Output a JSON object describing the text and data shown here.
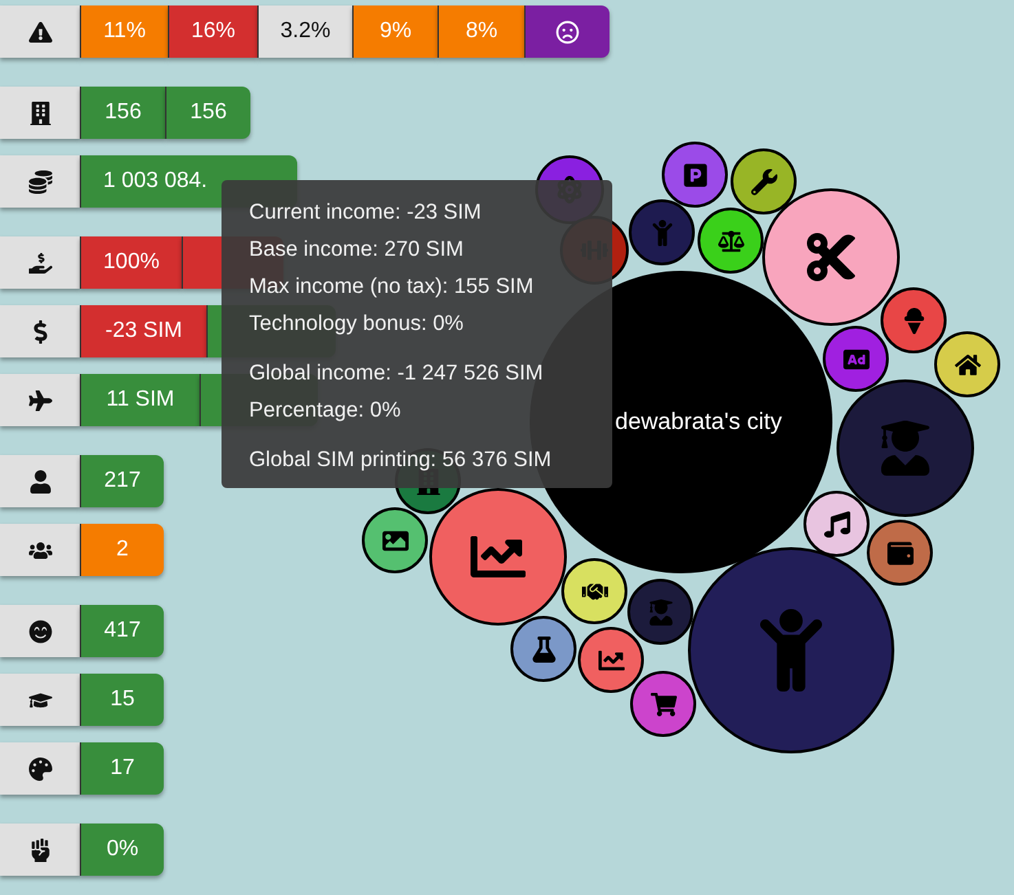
{
  "stat_sections": [
    [
      {
        "segments": [
          {
            "kind": "text",
            "text": "11%",
            "color": "#f57c00"
          },
          {
            "kind": "text",
            "text": "16%",
            "color": "#d32f2f"
          },
          {
            "kind": "text",
            "text": "3.2%",
            "color": "#e0e0e0"
          },
          {
            "kind": "text",
            "text": "9%",
            "color": "#f57c00"
          },
          {
            "kind": "text",
            "text": "8%",
            "color": "#f57c00"
          },
          {
            "kind": "icon",
            "color": "#7b1fa2"
          }
        ]
      }
    ],
    [
      {
        "segments": [
          {
            "kind": "text",
            "text": "156",
            "color": "#388e3c"
          },
          {
            "kind": "text",
            "text": "156",
            "color": "#388e3c"
          }
        ]
      },
      {
        "segments": [
          {
            "kind": "text",
            "text": "1 003 084.",
            "color": "#388e3c"
          }
        ]
      }
    ],
    [
      {
        "segments": [
          {
            "kind": "text",
            "text": "100%",
            "color": "#d32f2f"
          },
          {
            "kind": "blank",
            "color": "#d32f2f"
          }
        ]
      },
      {
        "segments": [
          {
            "kind": "text",
            "text": "-23 SIM",
            "color": "#d32f2f"
          },
          {
            "kind": "blank",
            "color": "#388e3c"
          }
        ]
      },
      {
        "segments": [
          {
            "kind": "text",
            "text": "11 SIM",
            "color": "#388e3c"
          },
          {
            "kind": "blank",
            "color": "#388e3c"
          }
        ]
      }
    ],
    [
      {
        "segments": [
          {
            "kind": "text",
            "text": "217",
            "color": "#388e3c"
          }
        ]
      },
      {
        "segments": [
          {
            "kind": "text",
            "text": "2",
            "color": "#f57c00"
          }
        ]
      }
    ],
    [
      {
        "segments": [
          {
            "kind": "text",
            "text": "417",
            "color": "#388e3c"
          }
        ]
      },
      {
        "segments": [
          {
            "kind": "text",
            "text": "15",
            "color": "#388e3c"
          }
        ]
      },
      {
        "segments": [
          {
            "kind": "text",
            "text": "17",
            "color": "#388e3c"
          }
        ]
      }
    ],
    [
      {
        "segments": [
          {
            "kind": "text",
            "text": "0%",
            "color": "#388e3c"
          }
        ]
      }
    ]
  ],
  "city": {
    "name": "dewabrata's city"
  },
  "bubbles": [
    {
      "color": "#8a20e0"
    },
    {
      "color": "#b02010"
    },
    {
      "color": "#1a7a40"
    },
    {
      "color": "#1e1b50"
    },
    {
      "color": "#9b4be8"
    },
    {
      "color": "#98b526"
    },
    {
      "color": "#3ad01a"
    },
    {
      "color": "#f8a5bd"
    },
    {
      "color": "#e84646"
    },
    {
      "color": "#a020e0"
    },
    {
      "color": "#d6cc4a"
    },
    {
      "color": "#1c1a3c"
    },
    {
      "color": "#e8c4e0"
    },
    {
      "color": "#bf6b48"
    },
    {
      "color": "#221e58"
    },
    {
      "color": "#cc44cc"
    },
    {
      "color": "#f06060"
    },
    {
      "color": "#1c1b3c"
    },
    {
      "color": "#7b98c8"
    },
    {
      "color": "#d8e060"
    },
    {
      "color": "#f06060"
    },
    {
      "color": "#55c070"
    }
  ],
  "tooltip": {
    "groups": [
      [
        "Current income: -23 SIM",
        "Base income: 270 SIM",
        "Max income (no tax): 155 SIM",
        "Technology bonus: 0%"
      ],
      [
        "Global income: -1 247 526 SIM",
        "Percentage: 0%"
      ],
      [
        "Global SIM printing: 56 376 SIM"
      ]
    ]
  }
}
